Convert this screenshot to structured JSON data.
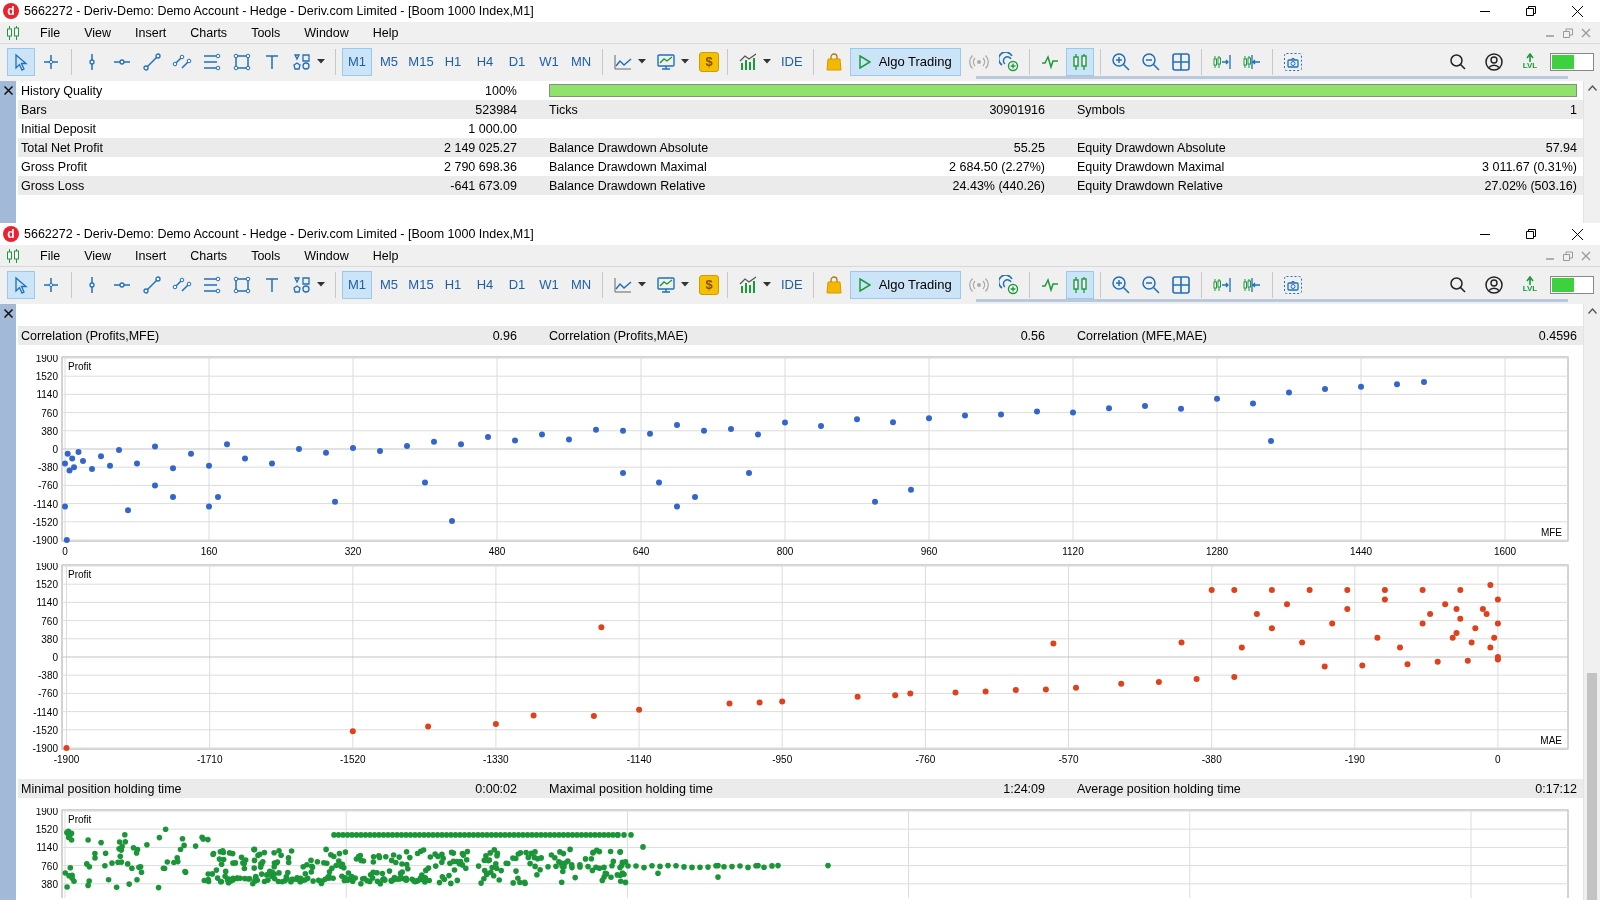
{
  "windows": [
    {
      "app_logo": "d",
      "title": "5662272 - Deriv-Demo: Demo Account - Hedge - Deriv.com Limited - [Boom 1000 Index,M1]",
      "menu": [
        "File",
        "View",
        "Insert",
        "Charts",
        "Tools",
        "Window",
        "Help"
      ],
      "toolbar": {
        "tools": [
          {
            "selected": true
          },
          {
            "selected": false
          },
          {
            "selected": false
          },
          {
            "selected": false
          },
          {
            "selected": false
          },
          {
            "selected": false
          },
          {
            "selected": false
          },
          {
            "selected": false
          },
          {
            "selected": false
          },
          {
            "selected": false
          }
        ],
        "timeframes": [
          {
            "label": "M1",
            "selected": true
          },
          {
            "label": "M5",
            "selected": false
          },
          {
            "label": "M15",
            "selected": false
          },
          {
            "label": "H1",
            "selected": false
          },
          {
            "label": "H4",
            "selected": false
          },
          {
            "label": "D1",
            "selected": false
          },
          {
            "label": "W1",
            "selected": false
          },
          {
            "label": "MN",
            "selected": false
          }
        ],
        "coin_symbol": "$",
        "ide": "IDE",
        "algo_trading": {
          "label": "Algo Trading",
          "on": true
        },
        "views": [
          {
            "selected": false
          },
          {
            "selected": true
          }
        ],
        "lvl": "LVL"
      },
      "report": {
        "history_quality": {
          "label": "History Quality",
          "value": "100%",
          "level": 1.0
        },
        "rows": [
          [
            {
              "label": "Bars",
              "value": "523984"
            },
            {
              "label": "Ticks",
              "value": "30901916"
            },
            {
              "label": "Symbols",
              "value": "1"
            }
          ],
          [
            {
              "label": "Initial Deposit",
              "value": "1 000.00"
            }
          ],
          [
            {
              "label": "Total Net Profit",
              "value": "2 149 025.27"
            },
            {
              "label": "Balance Drawdown Absolute",
              "value": "55.25"
            },
            {
              "label": "Equity Drawdown Absolute",
              "value": "57.94"
            }
          ],
          [
            {
              "label": "Gross Profit",
              "value": "2 790 698.36"
            },
            {
              "label": "Balance Drawdown Maximal",
              "value": "2 684.50 (2.27%)"
            },
            {
              "label": "Equity Drawdown Maximal",
              "value": "3 011.67 (0.31%)"
            }
          ],
          [
            {
              "label": "Gross Loss",
              "value": "-641 673.09"
            },
            {
              "label": "Balance Drawdown Relative",
              "value": "24.43% (440.26)"
            },
            {
              "label": "Equity Drawdown Relative",
              "value": "27.02% (503.16)"
            }
          ]
        ]
      }
    },
    {
      "app_logo": "d",
      "title": "5662272 - Deriv-Demo: Demo Account - Hedge - Deriv.com Limited - [Boom 1000 Index,M1]",
      "menu": [
        "File",
        "View",
        "Insert",
        "Charts",
        "Tools",
        "Window",
        "Help"
      ],
      "toolbar": {
        "tools": [
          {
            "selected": true
          },
          {
            "selected": false
          },
          {
            "selected": false
          },
          {
            "selected": false
          },
          {
            "selected": false
          },
          {
            "selected": false
          },
          {
            "selected": false
          },
          {
            "selected": false
          },
          {
            "selected": false
          },
          {
            "selected": false
          }
        ],
        "timeframes": [
          {
            "label": "M1",
            "selected": true
          },
          {
            "label": "M5",
            "selected": false
          },
          {
            "label": "M15",
            "selected": false
          },
          {
            "label": "H1",
            "selected": false
          },
          {
            "label": "H4",
            "selected": false
          },
          {
            "label": "D1",
            "selected": false
          },
          {
            "label": "W1",
            "selected": false
          },
          {
            "label": "MN",
            "selected": false
          }
        ],
        "coin_symbol": "$",
        "ide": "IDE",
        "algo_trading": {
          "label": "Algo Trading",
          "on": true
        },
        "views": [
          {
            "selected": false
          },
          {
            "selected": true
          }
        ],
        "lvl": "LVL"
      },
      "report": {
        "sections": [
          {
            "kind": "stats",
            "cells": [
              {
                "label": "Correlation (Profits,MFE)",
                "value": "0.96"
              },
              {
                "label": "Correlation (Profits,MAE)",
                "value": "0.56"
              },
              {
                "label": "Correlation (MFE,MAE)",
                "value": "0.4596"
              }
            ]
          },
          {
            "kind": "chart",
            "chart_data": {
              "type": "scatter",
              "grid": true,
              "xlabel": "MFE",
              "ylabel": "Profit",
              "xlim": [
                -3.3,
                1670
              ],
              "ylim": [
                -1920,
                1920
              ],
              "xticks": [
                0,
                160,
                320,
                480,
                640,
                800,
                960,
                1120,
                1280,
                1440,
                1600
              ],
              "yticks": [
                1900,
                1520,
                1140,
                760,
                380,
                0,
                -380,
                -760,
                -1140,
                -1520,
                -1900
              ],
              "x": [
                0,
                3,
                5,
                8,
                10,
                15,
                20,
                30,
                40,
                50,
                60,
                80,
                100,
                120,
                140,
                160,
                180,
                200,
                230,
                260,
                290,
                320,
                350,
                380,
                410,
                440,
                470,
                500,
                530,
                560,
                590,
                620,
                650,
                680,
                710,
                740,
                770,
                800,
                840,
                880,
                920,
                960,
                1000,
                1040,
                1080,
                1120,
                1160,
                1200,
                1240,
                1280,
                1320,
                1360,
                1400,
                1440,
                1480,
                1510,
                2,
                0,
                70,
                100,
                120,
                160,
                170,
                300,
                400,
                430,
                620,
                660,
                680,
                700,
                760,
                900,
                940,
                1340
              ],
              "series": [
                {
                  "color": "#3366cc",
                  "values": [
                    -300,
                    -100,
                    -450,
                    -200,
                    -380,
                    -60,
                    -250,
                    -420,
                    -150,
                    -350,
                    -20,
                    -300,
                    50,
                    -400,
                    -100,
                    -350,
                    100,
                    -200,
                    -300,
                    0,
                    -80,
                    20,
                    -40,
                    60,
                    150,
                    100,
                    250,
                    180,
                    300,
                    200,
                    400,
                    380,
                    320,
                    500,
                    380,
                    420,
                    300,
                    550,
                    480,
                    620,
                    560,
                    640,
                    700,
                    720,
                    780,
                    760,
                    850,
                    900,
                    840,
                    1050,
                    950,
                    1180,
                    1250,
                    1300,
                    1350,
                    1400,
                    -1900,
                    -1200,
                    -1280,
                    -760,
                    -1000,
                    -1200,
                    -1000,
                    -1100,
                    -700,
                    -1500,
                    -500,
                    -700,
                    -1200,
                    -1000,
                    -500,
                    -1100,
                    -850,
                    170
                  ]
                }
              ]
            }
          },
          {
            "kind": "chart",
            "chart_data": {
              "type": "scatter",
              "grid": true,
              "xlabel": "MAE",
              "ylabel": "Profit",
              "xlim": [
                -1906,
                93
              ],
              "ylim": [
                -1920,
                1920
              ],
              "xticks": [
                -1900,
                -1710,
                -1520,
                -1330,
                -1140,
                -950,
                -760,
                -570,
                -380,
                -190,
                0
              ],
              "yticks": [
                1900,
                1520,
                1140,
                760,
                380,
                0,
                -380,
                -760,
                -1140,
                -1520,
                -1900
              ],
              "x": [
                -1900,
                -1520,
                -1420,
                -1330,
                -1280,
                -1200,
                -1140,
                -1020,
                -980,
                -950,
                -850,
                -800,
                -780,
                -720,
                -680,
                -640,
                -600,
                -560,
                -500,
                -450,
                -400,
                -350,
                -1190,
                -590,
                -420,
                -380,
                -350,
                -300,
                -250,
                -200,
                -150,
                -100,
                -50,
                -10,
                -340,
                -320,
                -300,
                -280,
                -260,
                -230,
                -220,
                -200,
                -180,
                -160,
                -150,
                -130,
                -120,
                -100,
                -90,
                -80,
                -70,
                -60,
                -50,
                -40,
                -30,
                -20,
                -10,
                0,
                0,
                0,
                0,
                -5,
                -55,
                -55,
                -35,
                -15
              ],
              "series": [
                {
                  "color": "#e0401a",
                  "values": [
                    -1900,
                    -1550,
                    -1450,
                    -1400,
                    -1220,
                    -1230,
                    -1100,
                    -970,
                    -950,
                    -930,
                    -830,
                    -800,
                    -760,
                    -740,
                    -720,
                    -690,
                    -680,
                    -640,
                    -560,
                    -520,
                    -460,
                    -420,
                    620,
                    280,
                    300,
                    1400,
                    1400,
                    1400,
                    1400,
                    1400,
                    1400,
                    1400,
                    1400,
                    1500,
                    200,
                    900,
                    600,
                    1100,
                    300,
                    -200,
                    700,
                    1000,
                    -180,
                    400,
                    1200,
                    200,
                    -150,
                    700,
                    900,
                    -100,
                    1100,
                    400,
                    800,
                    -80,
                    600,
                    1000,
                    200,
                    0,
                    700,
                    1200,
                    -50,
                    400,
                    500,
                    1000,
                    300,
                    900
                  ]
                }
              ]
            }
          },
          {
            "kind": "stats",
            "cells": [
              {
                "label": "Minimal position holding time",
                "value": "0:00:02"
              },
              {
                "label": "Maximal position holding time",
                "value": "1:24:09"
              },
              {
                "label": "Average position holding time",
                "value": "0:17:12"
              }
            ]
          },
          {
            "kind": "dots_picture",
            "ylabel": "Profit",
            "yticks": [
              "1900",
              "1520",
              "1140",
              "760",
              "380"
            ],
            "color": "#1a9638"
          }
        ]
      }
    }
  ]
}
